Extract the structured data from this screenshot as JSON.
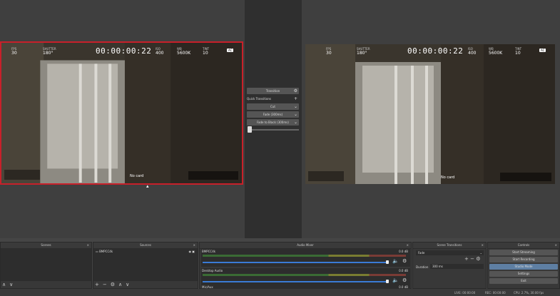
{
  "left_preview": {
    "fps_label": "FPS",
    "fps_value": "30",
    "shutter_label": "SHUTTER",
    "shutter_value": "180°",
    "iso_label": "ISO",
    "iso_value": "400",
    "wb_label": "WB",
    "wb_value": "5600K",
    "tint_label": "TINT",
    "tint_value": "10",
    "timecode": "00:00:00:22",
    "card_text": "No card"
  },
  "right_preview": {
    "fps_label": "FPS",
    "fps_value": "30",
    "shutter_label": "SHUTTER",
    "shutter_value": "180°",
    "iso_label": "ISO",
    "iso_value": "400",
    "wb_label": "WB",
    "wb_value": "5600K",
    "tint_label": "TINT",
    "tint_value": "10",
    "timecode": "00:00:00:22",
    "card_text": "No card"
  },
  "transitions": {
    "transition_button": "Transition",
    "quick_label": "Quick Transitions",
    "items": [
      "Cut",
      "Fade (300ms)",
      "Fade to Black (300ms)"
    ]
  },
  "docks": {
    "scenes_title": "Scenes",
    "sources_title": "Sources",
    "source_item": "BMPCC4k",
    "mixer_title": "Audio Mixer",
    "mixer_tracks": [
      {
        "name": "BMPCC4k",
        "db": "0.0 dB"
      },
      {
        "name": "Desktop Audio",
        "db": "0.0 dB"
      },
      {
        "name": "Mic/Aux",
        "db": "0.0 dB"
      }
    ],
    "scene_transitions_title": "Scene Transitions",
    "transition_select": "Fade",
    "duration_label": "Duration",
    "duration_value": "300 ms",
    "controls_title": "Controls",
    "controls": [
      "Start Streaming",
      "Start Recording",
      "Studio Mode",
      "Settings",
      "Exit"
    ]
  },
  "status_bar": {
    "live": "LIVE: 00:00:00",
    "rec": "REC: 00:00:00",
    "cpu": "CPU: 2.7%, 30.00 fps"
  },
  "colors": {
    "accent_red": "#c8202a",
    "studio_mode_blue": "#5e7fa3"
  }
}
